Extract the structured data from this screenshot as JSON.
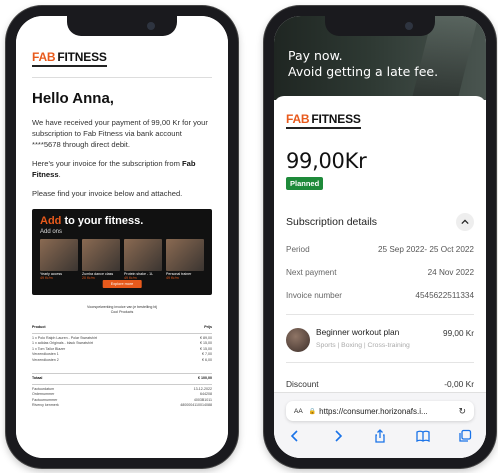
{
  "email": {
    "logo": {
      "fab": "FAB",
      "fitness": "FITNESS"
    },
    "greeting": "Hello Anna,",
    "paragraph1": "We have received your payment of 99,00 Kr for your subscription to Fab Fitness via bank account ****5678 through direct debit.",
    "paragraph2_prefix": "Here's your invoice for the subscription from ",
    "paragraph2_brand": "Fab Fitness",
    "paragraph2_suffix": ".",
    "paragraph3": "Please find your invoice below and attached.",
    "banner": {
      "add": "Add",
      "rest": " to your fitness.",
      "subtitle": "Add ons",
      "tiles": [
        {
          "label": "Yearly access",
          "price": "49 Kr/m"
        },
        {
          "label": "Zumba dance class",
          "price": "20 Kr/m"
        },
        {
          "label": "Protein shake - 1L",
          "price": "49 Kr/m"
        },
        {
          "label": "Personal trainer",
          "price": "49 Kr/m"
        }
      ],
      "cta": "Explore more"
    },
    "invoice": {
      "heading_line1": "Voorspelwerking invoice van je bestelling bij",
      "heading_line2": "Cool Products",
      "columns": {
        "product": "Product",
        "price": "Prijs"
      },
      "rows": [
        {
          "item": "1 x Polo Ralph Lauren - Polar Sweatshirt",
          "price": "€ 89,00"
        },
        {
          "item": "1 x adidas Originals - black Sweatshirt",
          "price": "€ 15,00"
        },
        {
          "item": "1 x Tom Tailor Blazer",
          "price": "€ 15,00"
        },
        {
          "item": "Verzendkosten 1",
          "price": "€ 7,00"
        },
        {
          "item": "Verzendkosten 2",
          "price": "€ 6,00"
        }
      ],
      "total_label": "Totaal",
      "total_value": "€ 100,00",
      "meta": [
        {
          "label": "Factuurdatum",
          "value": "13-12-2022"
        },
        {
          "label": "Ordernummer",
          "value": "644208"
        },
        {
          "label": "Factuurnummer",
          "value": "4003B1011"
        },
        {
          "label": "Rivercy kenmerk",
          "value": "4800004110014088"
        }
      ]
    }
  },
  "web": {
    "hero_line1": "Pay now.",
    "hero_line2": "Avoid getting a late fee.",
    "logo": {
      "fab": "FAB",
      "fitness": "FITNESS"
    },
    "amount": "99,00Kr",
    "status": "Planned",
    "section_title": "Subscription details",
    "details": [
      {
        "label": "Period",
        "value": "25 Sep 2022- 25 Oct 2022"
      },
      {
        "label": "Next payment",
        "value": "24 Nov 2022"
      },
      {
        "label": "Invoice number",
        "value": "4545622511334"
      }
    ],
    "plan": {
      "name": "Beginner workout plan",
      "tags": "Sports | Boxing | Cross-training",
      "price": "99,00 Kr"
    },
    "discount": {
      "label": "Discount",
      "value": "-0,00 Kr"
    },
    "browser": {
      "aa": "AA",
      "url": "https://consumer.horizonafs.i..."
    }
  },
  "colors": {
    "accent": "#e85a1c",
    "status_green": "#1e8a3a",
    "link_blue": "#1a73e8"
  }
}
